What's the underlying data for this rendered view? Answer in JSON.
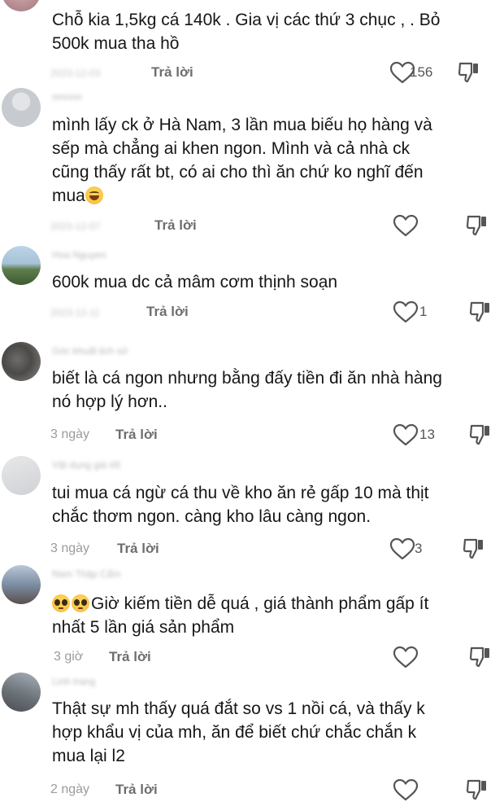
{
  "colors": {
    "text": "#161616",
    "muted": "#9b9b9b",
    "reply": "#6e6e6e",
    "icon": "#555555"
  },
  "comments": [
    {
      "text": "Chỗ kia 1,5kg cá 140k . Gia vị các thứ 3 chục , . Bỏ\n500k mua tha hồ",
      "time": "2023-12-03",
      "reply": "Trả lời",
      "likes": "156",
      "avatar_icon": "user-avatar"
    },
    {
      "username": "nmnnn",
      "text": "mình lấy ck ở Hà Nam, 3 lần mua biếu họ hàng và\nsếp mà chẳng ai khen ngon. Mình và cả nhà ck\ncũng thấy rất bt, có ai cho thì ăn chứ ko nghĩ đến\nmua",
      "emoji": "grinning-face",
      "time": "2023-12-07",
      "reply": "Trả lời",
      "likes": "",
      "avatar_icon": "user-avatar"
    },
    {
      "username": "Hoa Nguyen",
      "text": "600k mua dc cả mâm cơm thịnh soạn",
      "time": "2023-12-11",
      "reply": "Trả lời",
      "likes": "1",
      "avatar_icon": "user-avatar"
    },
    {
      "username": "Góc khuất lịch sử",
      "text": "biết là cá ngon nhưng bằng đấy tiền đi ăn nhà hàng\nnó hợp lý hơn..",
      "time": "3 ngày",
      "reply": "Trả lời",
      "likes": "13",
      "avatar_icon": "user-avatar"
    },
    {
      "username": "Vật dụng giá tốt",
      "text": "tui mua cá ngừ cá thu về kho ăn rẻ gấp 10 mà thịt\nchắc thơm ngon. càng kho lâu càng ngon.",
      "time": "3 ngày",
      "reply": "Trả lời",
      "likes": "3",
      "avatar_icon": "user-avatar"
    },
    {
      "username": "Nam Thập Cẩm",
      "text": "Giờ kiếm tiền dễ quá , giá thành phẩm gấp ít\nnhất 5 lần giá sản phẩm",
      "emoji": "pleading-face",
      "time": "3 giờ",
      "reply": "Trả lời",
      "likes": "",
      "avatar_icon": "user-avatar"
    },
    {
      "username": "Linh trang",
      "text": "Thật sự mh thấy quá đắt so vs 1 nồi cá, và thấy k\nhợp khẩu vị của mh, ăn để biết chứ chắc chắn k\nmua lại l2",
      "time": "2 ngày",
      "reply": "Trả lời",
      "likes": "",
      "avatar_icon": "user-avatar"
    }
  ]
}
